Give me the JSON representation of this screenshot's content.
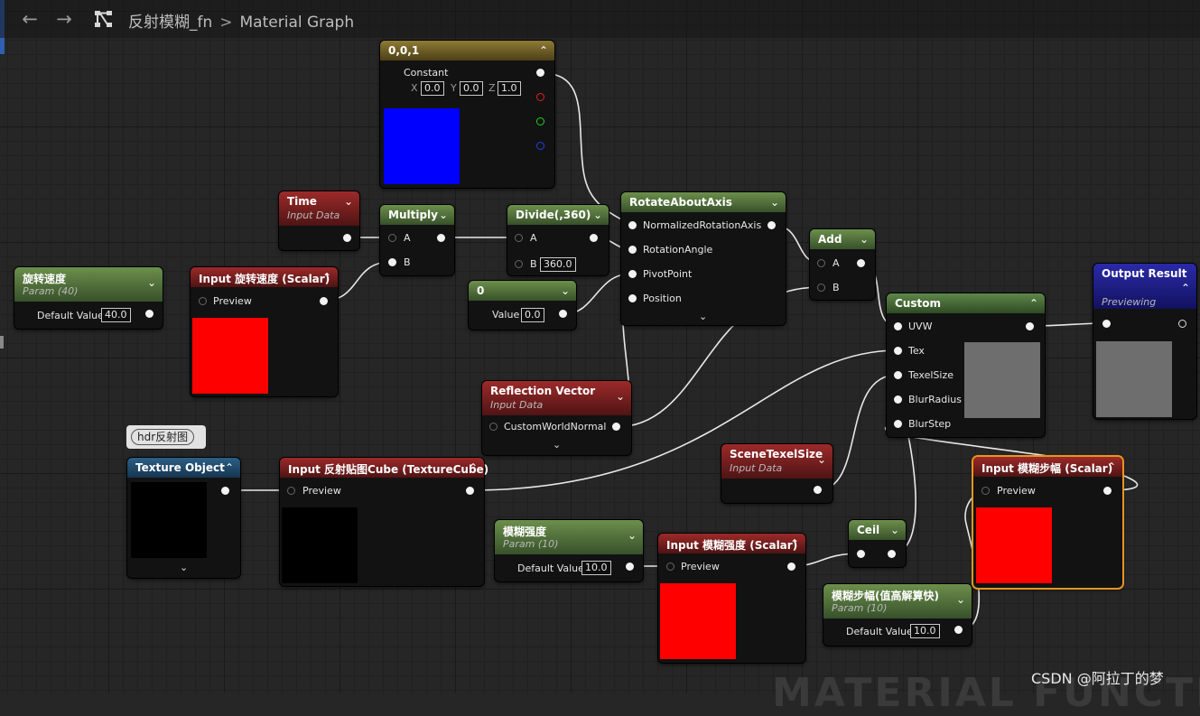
{
  "breadcrumb": {
    "function_name": "反射模糊_fn",
    "separator": ">",
    "graph": "Material Graph"
  },
  "nav": {
    "back_glyph": "←",
    "forward_glyph": "→"
  },
  "comment": {
    "text": "hdr反射图"
  },
  "nodes": {
    "constant3": {
      "title": "0,0,1",
      "output_label": "Constant",
      "x_label": "X",
      "x": "0.0",
      "y_label": "Y",
      "y": "0.0",
      "z_label": "Z",
      "z": "1.0",
      "preview_color": "#0000ff"
    },
    "time": {
      "title": "Time",
      "subtitle": "Input Data"
    },
    "multiply": {
      "title": "Multiply",
      "a": "A",
      "b": "B"
    },
    "divide": {
      "title": "Divide(,360)",
      "a": "A",
      "b_label": "B",
      "b": "360.0"
    },
    "rotate": {
      "title": "RotateAboutAxis",
      "pins": [
        "NormalizedRotationAxis",
        "RotationAngle",
        "PivotPoint",
        "Position"
      ]
    },
    "add": {
      "title": "Add",
      "a": "A",
      "b": "B"
    },
    "output": {
      "title": "Output Result",
      "subtitle": "Previewing",
      "preview_color": "#6e6e6e"
    },
    "custom": {
      "title": "Custom",
      "pins": [
        "UVW",
        "Tex",
        "TexelSize",
        "BlurRadius",
        "BlurStep"
      ],
      "preview_color": "#6e6e6e"
    },
    "rot_speed_param": {
      "title": "旋转速度",
      "subtitle": "Param (40)",
      "label": "Default Value",
      "value": "40.0"
    },
    "input_rot_speed": {
      "title": "Input 旋转速度 (Scalar)",
      "pin": "Preview",
      "preview_color": "#ff0000"
    },
    "zero_const": {
      "title": "0",
      "label": "Value",
      "value": "0.0"
    },
    "reflection": {
      "title": "Reflection Vector",
      "subtitle": "Input Data",
      "pin": "CustomWorldNormal"
    },
    "texture_object": {
      "title": "Texture Object",
      "preview_color": "#000000"
    },
    "input_cube": {
      "title": "Input 反射贴图Cube (TextureCube)",
      "pin": "Preview",
      "preview_color": "#000000"
    },
    "scene_texel": {
      "title": "SceneTexelSize",
      "subtitle": "Input Data"
    },
    "blur_strength_param": {
      "title": "模糊强度",
      "subtitle": "Param (10)",
      "label": "Default Value",
      "value": "10.0"
    },
    "input_blur_strength": {
      "title": "Input 模糊强度 (Scalar)",
      "pin": "Preview",
      "preview_color": "#ff0000"
    },
    "ceil": {
      "title": "Ceil"
    },
    "input_blur_step": {
      "title": "Input 模糊步幅 (Scalar)",
      "pin": "Preview",
      "preview_color": "#ff0000"
    },
    "blur_step_param": {
      "title": "模糊步幅(值高解算快)",
      "subtitle": "Param (10)",
      "label": "Default Value",
      "value": "10.0"
    }
  },
  "watermark": "MATERIAL FUNCTI",
  "credit": "CSDN @阿拉丁的梦"
}
